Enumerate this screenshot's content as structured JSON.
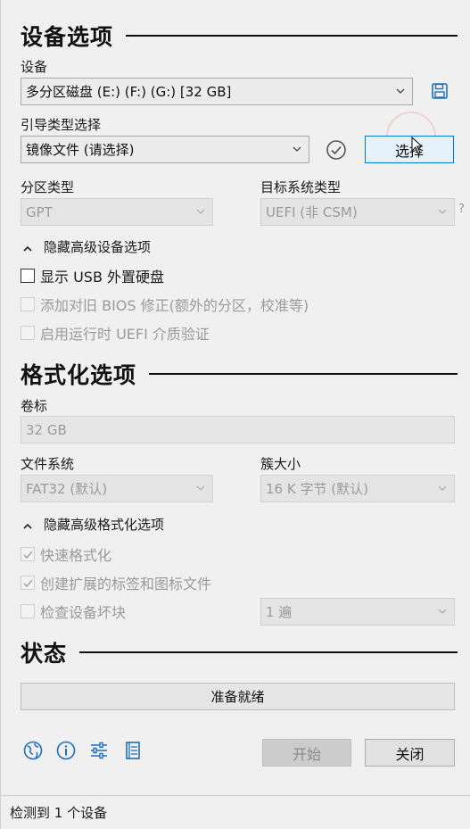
{
  "device_section": {
    "title": "设备选项",
    "device_label": "设备",
    "device_value": "多分区磁盘 (E:) (F:) (G:) [32 GB]",
    "boot_label": "引导类型选择",
    "boot_value": "镜像文件 (请选择)",
    "select_button": "选择",
    "partition_label": "分区类型",
    "partition_value": "GPT",
    "target_label": "目标系统类型",
    "target_value": "UEFI (非 CSM)",
    "target_help": "?",
    "advanced_toggle": "隐藏高级设备选项",
    "options": [
      {
        "label": "显示 USB 外置硬盘",
        "checked": false,
        "enabled": true
      },
      {
        "label": "添加对旧 BIOS 修正(额外的分区，校准等)",
        "checked": false,
        "enabled": false
      },
      {
        "label": "启用运行时 UEFI 介质验证",
        "checked": false,
        "enabled": false
      }
    ]
  },
  "format_section": {
    "title": "格式化选项",
    "volume_label": "卷标",
    "volume_value": "32 GB",
    "fs_label": "文件系统",
    "fs_value": "FAT32 (默认)",
    "cluster_label": "簇大小",
    "cluster_value": "16 K 字节 (默认)",
    "advanced_toggle": "隐藏高级格式化选项",
    "options": [
      {
        "label": "快速格式化",
        "checked": true,
        "enabled": false
      },
      {
        "label": "创建扩展的标签和图标文件",
        "checked": true,
        "enabled": false
      },
      {
        "label": "检查设备坏块",
        "checked": false,
        "enabled": false
      }
    ],
    "passes_value": "1 遍"
  },
  "status_section": {
    "title": "状态",
    "progress_text": "准备就绪"
  },
  "footer": {
    "start_button": "开始",
    "close_button": "关闭",
    "icons": [
      "globe-icon",
      "info-icon",
      "settings-sliders-icon",
      "log-icon"
    ]
  },
  "status_bar": {
    "text": "检测到 1 个设备"
  },
  "colors": {
    "accent": "#0078d7",
    "icon_blue": "#1f6fb8",
    "background": "#f0f0f0"
  }
}
